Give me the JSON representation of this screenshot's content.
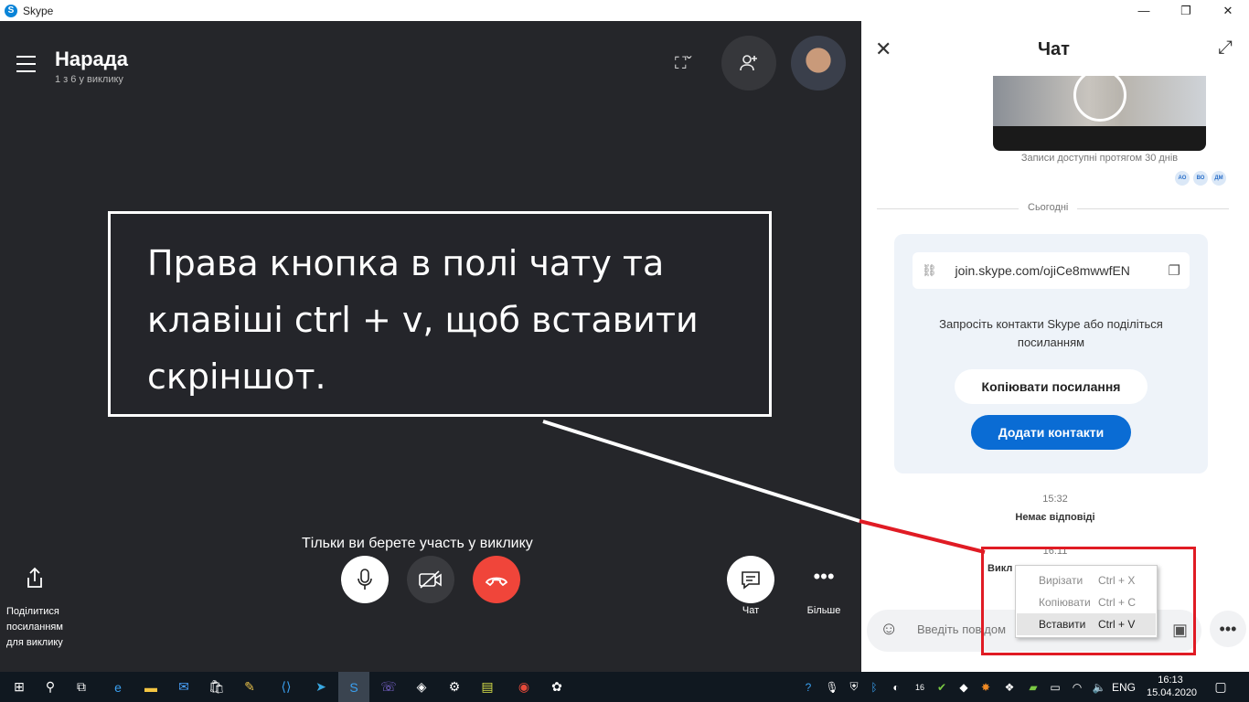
{
  "window": {
    "title": "Skype",
    "logo_letter": "S"
  },
  "call": {
    "title": "Нарада",
    "subtitle": "1 з 6 у виклику",
    "status_message": "Тільки ви берете участь у виклику",
    "share_label": "Поділитися посиланням для виклику",
    "chat_label": "Чат",
    "more_label": "Більше"
  },
  "annotation": {
    "text": "Права кнопка в полі чату та клавіші ctrl + v, щоб вставити скріншот."
  },
  "chat": {
    "title": "Чат",
    "recording_note": "Записи доступні протягом 30 днів",
    "seen_by": [
      "АО",
      "ВО",
      "ДМ"
    ],
    "separator": "Сьогодні",
    "invite": {
      "link": "join.skype.com/ojiCe8mwwfEN",
      "text": "Запросіть контакти Skype або поділіться посиланням",
      "copy_button": "Копіювати посилання",
      "add_button": "Додати контакти"
    },
    "time1": "15:32",
    "no_answer": "Немає відповіді",
    "time2": "16:11",
    "call_partial": "Викл",
    "input_placeholder": "Введіть повідом"
  },
  "context_menu": {
    "items": [
      {
        "label": "Вирізати",
        "shortcut": "Ctrl + X"
      },
      {
        "label": "Копіювати",
        "shortcut": "Ctrl + C"
      },
      {
        "label": "Вставити",
        "shortcut": "Ctrl + V"
      }
    ]
  },
  "taskbar": {
    "language": "ENG",
    "time": "16:13",
    "date": "15.04.2020",
    "badge": "16"
  },
  "colors": {
    "accent_blue": "#0a6cd4",
    "end_call_red": "#f0453a",
    "highlight_red": "#e01b24"
  }
}
